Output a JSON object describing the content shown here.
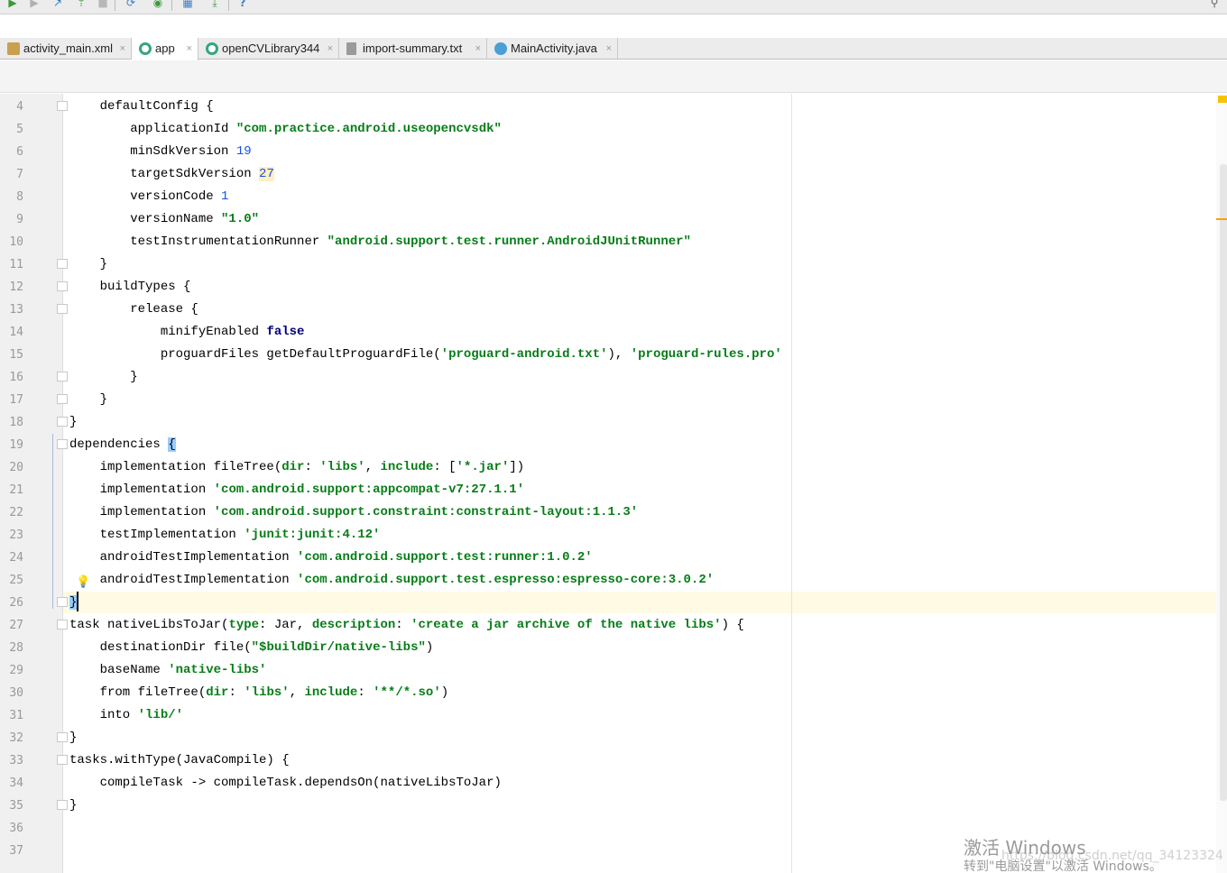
{
  "toolbar": {
    "icons": [
      "run-icon",
      "debug-icon",
      "attach-icon",
      "profile-icon",
      "stop-icon",
      "sync-icon",
      "android-icon",
      "structure-icon",
      "sdk-icon",
      "help-icon",
      "search-icon"
    ]
  },
  "tabs": [
    {
      "label": "activity_main.xml",
      "icon": "xml-file-icon",
      "color": "#c8a050",
      "active": false
    },
    {
      "label": "app",
      "icon": "gradle-module-icon",
      "color": "#35a77c",
      "active": true
    },
    {
      "label": "openCVLibrary344",
      "icon": "gradle-module-icon",
      "color": "#35a77c",
      "active": false
    },
    {
      "label": "import-summary.txt",
      "icon": "text-file-icon",
      "color": "#9a9a9a",
      "active": false
    },
    {
      "label": "MainActivity.java",
      "icon": "java-class-icon",
      "color": "#4a9fd4",
      "active": false
    }
  ],
  "tab_close_glyph": "×",
  "editor": {
    "line_numbers": [
      "4",
      "5",
      "6",
      "7",
      "8",
      "9",
      "10",
      "11",
      "12",
      "13",
      "14",
      "15",
      "16",
      "17",
      "18",
      "19",
      "20",
      "21",
      "22",
      "23",
      "24",
      "25",
      "26",
      "27",
      "28",
      "29",
      "30",
      "31",
      "32",
      "33",
      "34",
      "35",
      "36",
      "37"
    ],
    "current_line": "26"
  },
  "watermark": {
    "line1": "激活 Windows",
    "line2": "转到\"电脑设置\"以激活 Windows。",
    "url": "https://blog.csdn.net/qq_34123324"
  },
  "colors": {
    "string": "#067d17",
    "number": "#1750eb",
    "keyword": "#000080",
    "caret_row": "#fffae3",
    "gutter": "#f0f0f0"
  }
}
